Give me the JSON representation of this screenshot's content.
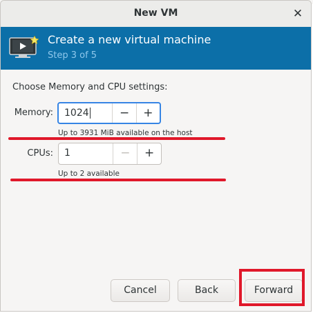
{
  "window": {
    "title": "New VM"
  },
  "header": {
    "title": "Create a new virtual machine",
    "step": "Step 3 of 5"
  },
  "content": {
    "section_label": "Choose Memory and CPU settings:",
    "memory": {
      "label": "Memory:",
      "value": "1024",
      "hint": "Up to 3931 MiB available on the host"
    },
    "cpus": {
      "label": "CPUs:",
      "value": "1",
      "hint": "Up to 2 available"
    }
  },
  "buttons": {
    "cancel": "Cancel",
    "back": "Back",
    "forward": "Forward"
  },
  "glyphs": {
    "minus": "−",
    "plus": "+",
    "close": "✕"
  },
  "colors": {
    "header_bg": "#0c6fa8",
    "annotation_red": "#e0182a",
    "focus_blue": "#3584e4"
  }
}
